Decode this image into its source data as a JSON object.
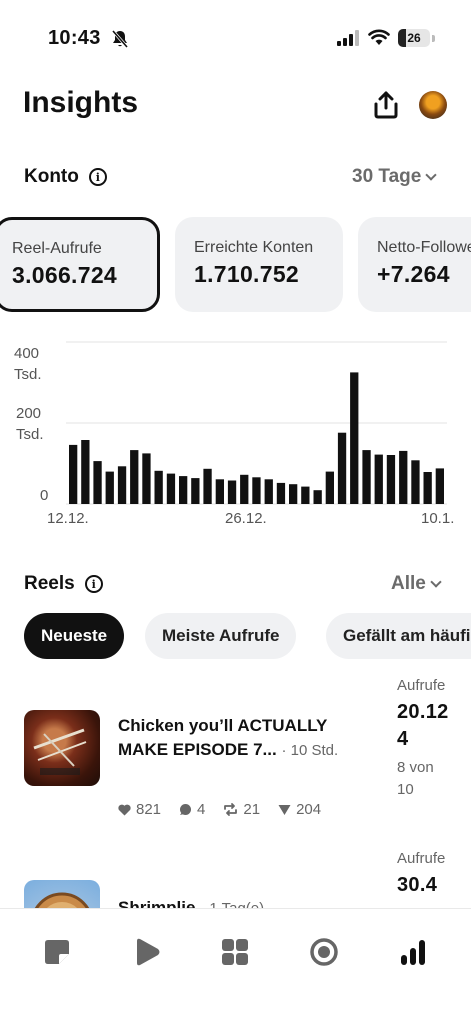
{
  "status_bar": {
    "time": "10:43",
    "battery": "26"
  },
  "header": {
    "title": "Insights"
  },
  "konto": {
    "title": "Konto",
    "range": "30 Tage",
    "cards": [
      {
        "label": "Reel-Aufrufe",
        "value": "3.066.724",
        "active": true
      },
      {
        "label": "Erreichte Konten",
        "value": "1.710.752",
        "active": false
      },
      {
        "label": "Netto-Follower",
        "value": "+7.264",
        "active": false
      }
    ]
  },
  "chart_data": {
    "type": "bar",
    "y_ticks": [
      "400\nTsd.",
      "200\nTsd.",
      "0"
    ],
    "ylim": [
      0,
      400000
    ],
    "x_ticks": [
      "12.12.",
      "26.12.",
      "10.1."
    ],
    "values": [
      146000,
      158000,
      106000,
      80000,
      93000,
      133000,
      125000,
      82000,
      75000,
      69000,
      64000,
      87000,
      61000,
      58000,
      72000,
      66000,
      61000,
      52000,
      49000,
      43000,
      34000,
      80000,
      176000,
      325000,
      133000,
      122000,
      121000,
      131000,
      108000,
      79000,
      88000
    ],
    "grid": true,
    "color": "#111111"
  },
  "reels": {
    "title": "Reels",
    "filter": "Alle",
    "tabs": [
      "Neueste",
      "Meiste Aufrufe",
      "Gefällt am häufigsten"
    ],
    "items": [
      {
        "title": "Chicken you’ll ACTUALLY MAKE EPISODE 7...",
        "time": "· 10 Std.",
        "likes": "821",
        "comments": "4",
        "shares": "21",
        "saves": "204",
        "metric_label": "Aufrufe",
        "metric_value": "20.124",
        "rank": "8 von 10"
      },
      {
        "title": "Shrimplie",
        "time": "· 1 Tag(e)",
        "metric_label": "Aufrufe",
        "metric_value": "30.4"
      }
    ]
  },
  "bottom_nav": [
    "home-icon",
    "reels-icon",
    "grid-icon",
    "record-icon",
    "insights-icon"
  ]
}
